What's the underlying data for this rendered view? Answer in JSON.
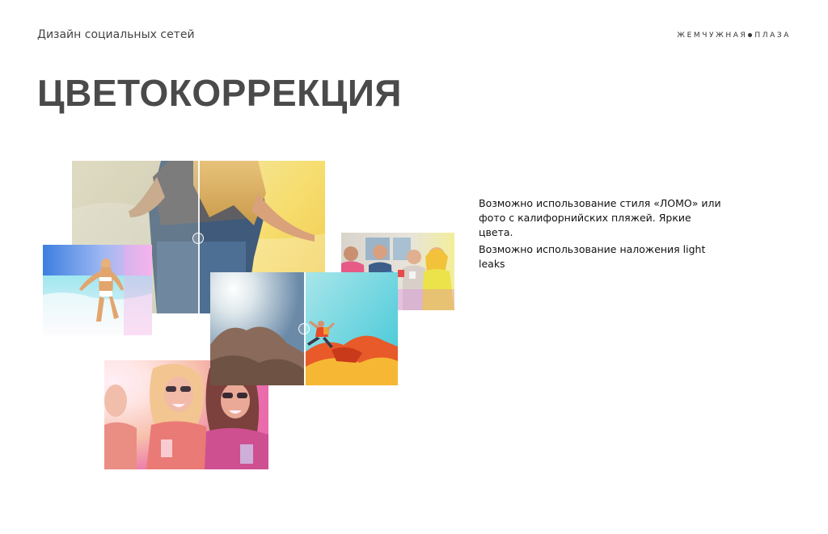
{
  "header": {
    "section_label": "Дизайн социальных сетей",
    "brand_left": "ЖЕМЧУЖНАЯ",
    "brand_right": "ПЛАЗА"
  },
  "title": "ЦВЕТОКОРРЕКЦИЯ",
  "description": {
    "line1": "Возможно использование стиля «ЛОМО» или фото с калифорнийских пляжей. Яркие цвета.",
    "line2": "Возможно использование наложения  light leaks"
  }
}
